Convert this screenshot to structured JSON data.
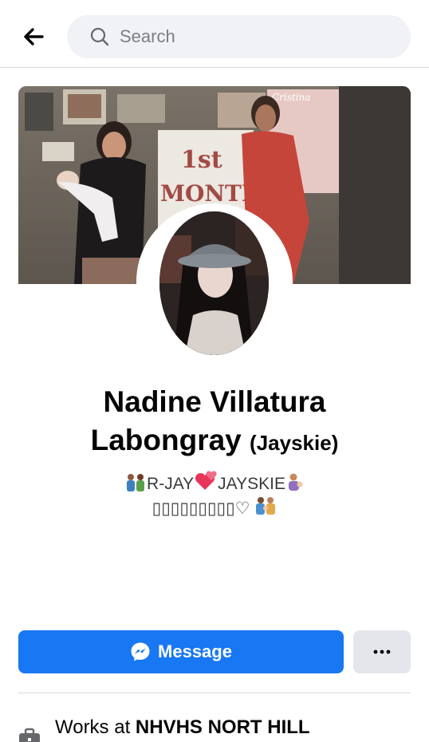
{
  "header": {
    "back_icon": "arrow-left-icon",
    "search_placeholder": "Search",
    "search_icon": "search-icon"
  },
  "cover": {
    "banner_line1": "1st",
    "banner_line2": "MONTH",
    "corner_text": "Cristina"
  },
  "profile": {
    "name": "Nadine Villatura Labongray",
    "nickname": "(Jayskie)",
    "bio_line1_left": "R-JAY",
    "bio_line1_right": "JAYSKIE",
    "bio_line2": "▯▯▯▯▯▯▯▯▯♡"
  },
  "actions": {
    "message_label": "Message",
    "message_icon": "messenger-icon",
    "more_icon": "more-dots-icon"
  },
  "intro": {
    "work_prefix": "Works at",
    "work_place": "NHVHS NORT HILL",
    "work_icon": "briefcase-icon"
  },
  "colors": {
    "brand_blue": "#1877f2",
    "secondary_button": "#e4e6eb",
    "search_bg": "#f0f2f5"
  }
}
